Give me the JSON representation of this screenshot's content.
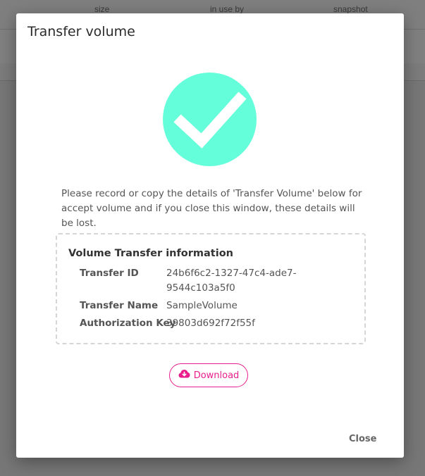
{
  "background": {
    "columns": [
      "size",
      "in use by",
      "snapshot"
    ]
  },
  "modal": {
    "title": "Transfer volume",
    "icon": "check-circle-icon",
    "accent_color": "#64ffda",
    "message": "Please record or copy the details of 'Transfer Volume' below for accept volume and if you close this window, these details will be lost.",
    "info": {
      "title": "Volume Transfer information",
      "rows": [
        {
          "label": "Transfer ID",
          "value": "24b6f6c2-1327-47c4-ade7-9544c103a5f0"
        },
        {
          "label": "Transfer Name",
          "value": "SampleVolume"
        },
        {
          "label": "Authorization Key",
          "value": "39803d692f72f55f"
        }
      ]
    },
    "download_label": "Download",
    "download_icon": "cloud-download-icon",
    "download_color": "#e91e8c",
    "close_label": "Close"
  }
}
